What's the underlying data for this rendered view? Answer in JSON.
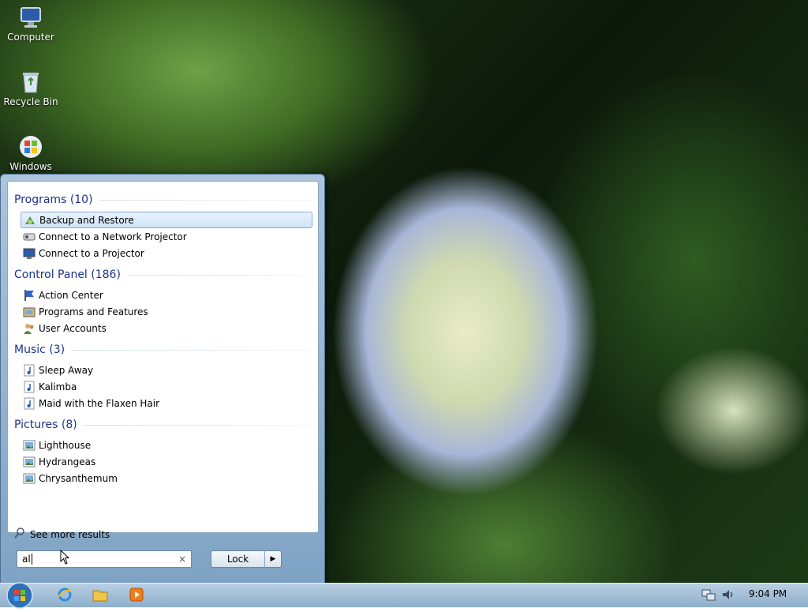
{
  "desktop": {
    "icons": [
      {
        "label": "Computer",
        "icon": "computer-icon"
      },
      {
        "label": "Recycle Bin",
        "icon": "recycle-bin-icon"
      },
      {
        "label": "Windows",
        "icon": "windows-icon"
      }
    ]
  },
  "start_menu": {
    "groups": [
      {
        "header": "Programs (10)",
        "items": [
          {
            "label": "Backup and Restore",
            "icon": "backup-restore-icon"
          },
          {
            "label": "Connect to a Network Projector",
            "icon": "network-projector-icon"
          },
          {
            "label": "Connect to a Projector",
            "icon": "projector-icon"
          }
        ]
      },
      {
        "header": "Control Panel (186)",
        "items": [
          {
            "label": "Action Center",
            "icon": "action-center-flag-icon"
          },
          {
            "label": "Programs and Features",
            "icon": "programs-features-icon"
          },
          {
            "label": "User Accounts",
            "icon": "user-accounts-icon"
          }
        ]
      },
      {
        "header": "Music (3)",
        "items": [
          {
            "label": "Sleep Away",
            "icon": "music-file-icon"
          },
          {
            "label": "Kalimba",
            "icon": "music-file-icon"
          },
          {
            "label": "Maid with the Flaxen Hair",
            "icon": "music-file-icon"
          }
        ]
      },
      {
        "header": "Pictures (8)",
        "items": [
          {
            "label": "Lighthouse",
            "icon": "picture-file-icon"
          },
          {
            "label": "Hydrangeas",
            "icon": "picture-file-icon"
          },
          {
            "label": "Chrysanthemum",
            "icon": "picture-file-icon"
          }
        ]
      }
    ],
    "see_more": "See more results",
    "search": {
      "value": "al",
      "clear": "×"
    },
    "lock_button": "Lock",
    "lock_arrow": "▶"
  },
  "taskbar": {
    "pinned": [
      "internet-explorer-icon",
      "windows-explorer-icon",
      "media-player-icon"
    ],
    "tray": [
      "network-icon",
      "volume-icon"
    ],
    "clock": "9:04 PM"
  },
  "colors": {
    "group_header": "#1e3287",
    "selection_border": "#84acdd"
  }
}
